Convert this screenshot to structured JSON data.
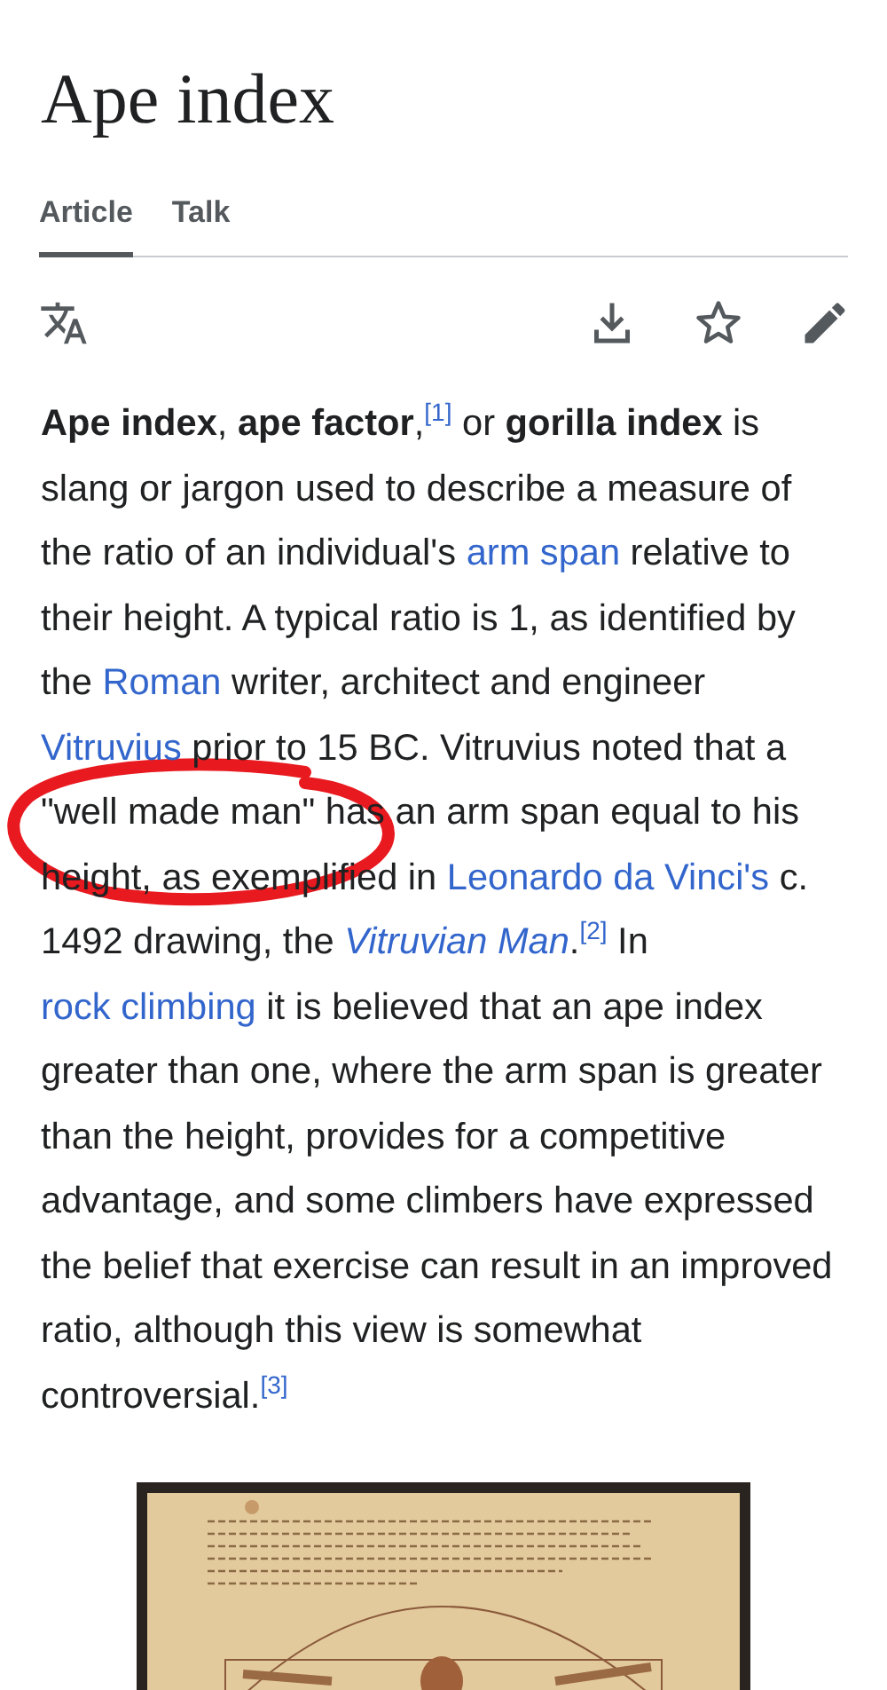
{
  "title": "Ape index",
  "tabs": [
    {
      "label": "Article",
      "selected": true
    },
    {
      "label": "Talk",
      "selected": false
    }
  ],
  "paragraph": [
    {
      "kind": "text",
      "text": "**Ape index**, **ape factor**,"
    },
    {
      "kind": "ref",
      "text": "[1]"
    },
    {
      "kind": "text",
      "text": " or **gorilla index** is slang or jargon used to describe a measure of the ratio of an individual's "
    },
    {
      "kind": "link",
      "text": "arm span"
    },
    {
      "kind": "text",
      "text": " relative to their height. A typical ratio is 1, as identified by the "
    },
    {
      "kind": "link",
      "text": "Roman"
    },
    {
      "kind": "text",
      "text": " writer, architect and engineer "
    },
    {
      "kind": "link",
      "text": "Vitruvius"
    },
    {
      "kind": "text",
      "text": " prior to 15 BC. Vitruvius noted that a \"well made man\" has an arm span equal to his height, as exemplified in "
    },
    {
      "kind": "link",
      "text": "Leonardo da Vinci's"
    },
    {
      "kind": "text",
      "text": " c. 1492 drawing, the "
    },
    {
      "kind": "link",
      "text": "*Vitruvian Man*"
    },
    {
      "kind": "text",
      "text": "."
    },
    {
      "kind": "ref",
      "text": "[2]"
    },
    {
      "kind": "text",
      "text": " In "
    },
    {
      "kind": "link",
      "text": "rock climbing"
    },
    {
      "kind": "text",
      "text": " it is believed that an ape index greater than one, where the arm span is greater than the height, provides for a competitive advantage, and some climbers have expressed the belief that exercise can result in an improved ratio, although this view is somewhat controversial."
    },
    {
      "kind": "ref",
      "text": "[3]"
    }
  ]
}
